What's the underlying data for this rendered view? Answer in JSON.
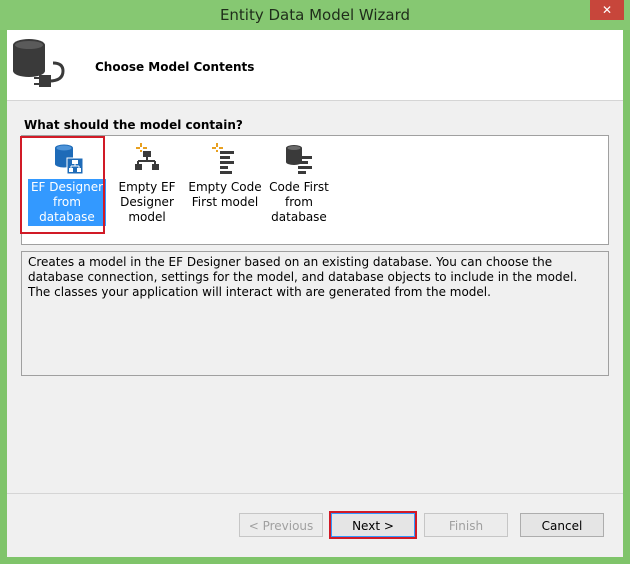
{
  "window": {
    "title": "Entity Data Model Wizard",
    "close_label": "✕"
  },
  "header": {
    "title": "Choose Model Contents",
    "icon": "database-connection-icon"
  },
  "question": "What should the model contain?",
  "choices": [
    {
      "label": "EF Designer from database",
      "icon": "ef-designer-database-icon",
      "selected": true
    },
    {
      "label": "Empty EF Designer model",
      "icon": "empty-ef-designer-icon",
      "selected": false
    },
    {
      "label": "Empty Code First model",
      "icon": "empty-code-first-icon",
      "selected": false
    },
    {
      "label": "Code First from database",
      "icon": "code-first-database-icon",
      "selected": false
    }
  ],
  "description": "Creates a model in the EF Designer based on an existing database. You can choose the database connection, settings for the model, and database objects to include in the model. The classes your application will interact with are generated from the model.",
  "buttons": {
    "previous": "< Previous",
    "next": "Next >",
    "finish": "Finish",
    "cancel": "Cancel"
  },
  "colors": {
    "titlebar": "#86c872",
    "selection": "#3399ff",
    "highlight_outline": "#d11a26"
  }
}
